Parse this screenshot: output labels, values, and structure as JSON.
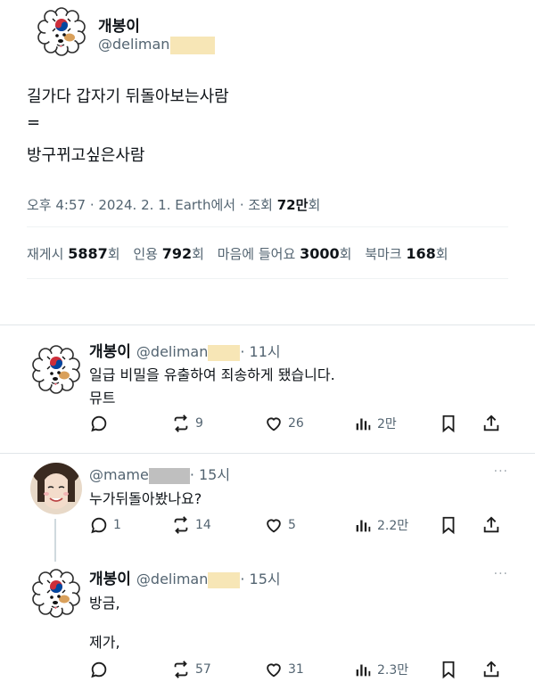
{
  "main_tweet": {
    "display_name": "개봉이",
    "handle": "@deliman",
    "lines": [
      "길가다 갑자기 뒤돌아보는사람",
      "=",
      "방구뀌고싶은사람"
    ],
    "meta": {
      "time_date": "오후 4:57 · 2024. 2. 1. Earth에서 · 조회",
      "views": "72만",
      "views_suffix": "회"
    },
    "stats": [
      {
        "label": "재게시",
        "value": "5887",
        "suffix": "회"
      },
      {
        "label": "인용",
        "value": "792",
        "suffix": "회"
      },
      {
        "label": "마음에 들어요",
        "value": "3000",
        "suffix": "회"
      },
      {
        "label": "북마크",
        "value": "168",
        "suffix": "회"
      }
    ]
  },
  "replies": [
    {
      "display_name": "개봉이",
      "handle": "@deliman",
      "time": "· 11시",
      "lines": [
        "일급 비밀을 유출하여 죄송하게 됐습니다.",
        "뮤트"
      ],
      "reply_count": "",
      "retweets": "9",
      "likes": "26",
      "views": "2만"
    },
    {
      "display_name": "",
      "handle": "@mame",
      "time": "· 15시",
      "lines": [
        "누가뒤돌아봤나요?"
      ],
      "reply_count": "1",
      "retweets": "14",
      "likes": "5",
      "views": "2.2만",
      "more": "···"
    },
    {
      "display_name": "개봉이",
      "handle": "@deliman",
      "time": "· 15시",
      "lines": [
        "방금,",
        "제가,"
      ],
      "reply_count": "",
      "retweets": "57",
      "likes": "31",
      "views": "2.3만",
      "more": "···"
    }
  ],
  "icons": [
    "reply-icon",
    "retweet-icon",
    "heart-icon",
    "views-icon",
    "bookmark-icon",
    "share-icon",
    "more-icon"
  ],
  "colors": {
    "text": "#0f1419",
    "secondary": "#536471",
    "mask_yellow": "#f7e6b6",
    "mask_gray": "#bfbfbf"
  }
}
